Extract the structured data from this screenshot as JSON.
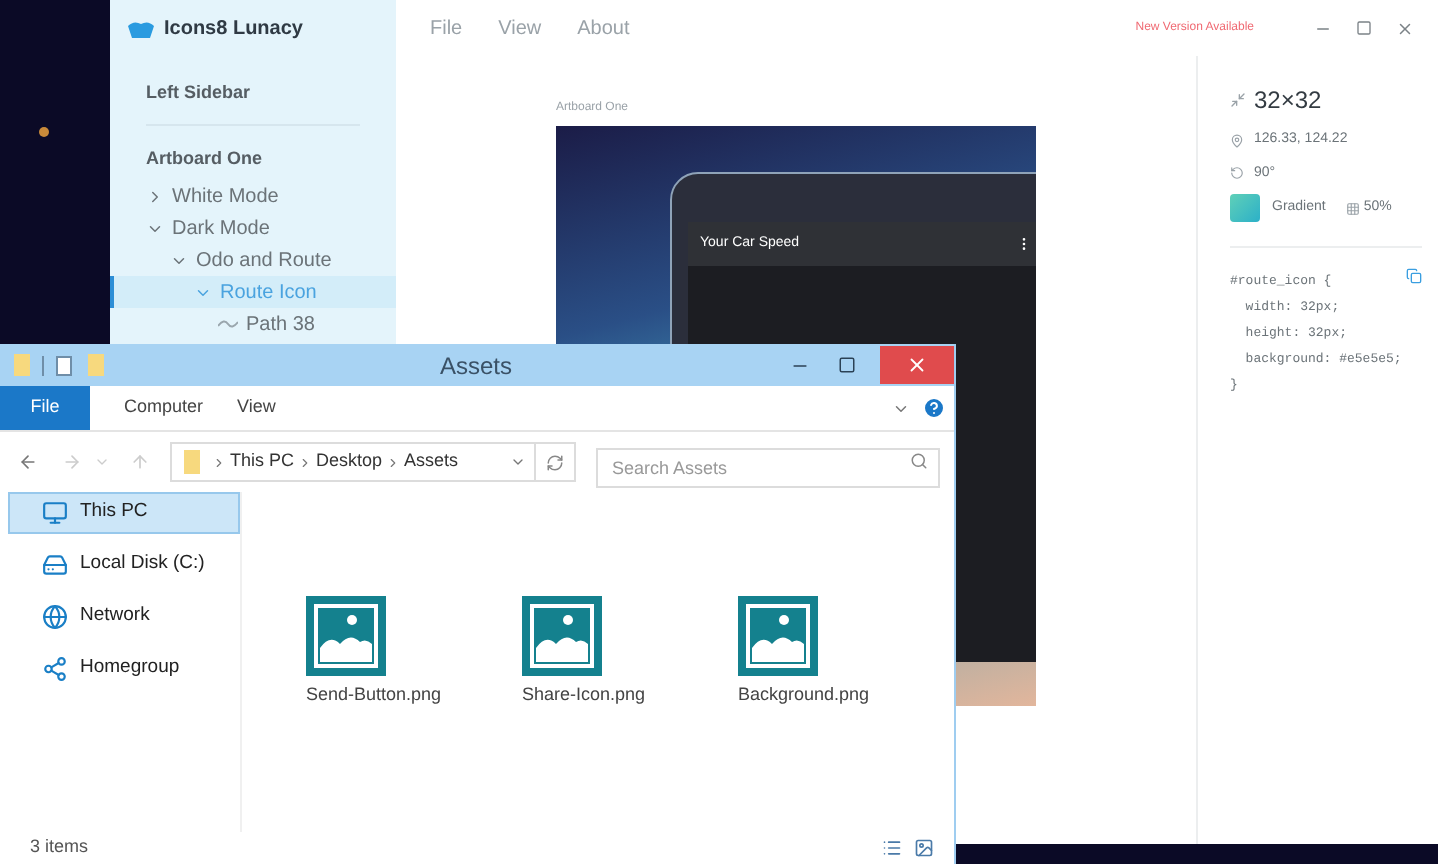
{
  "lunacy": {
    "title": "Icons8 Lunacy",
    "menu": [
      "File",
      "View",
      "About"
    ],
    "notice": "New Version Available",
    "sidebar": {
      "heading": "Left Sidebar",
      "artboard": "Artboard One",
      "layers": [
        {
          "label": "White Mode",
          "kind": "group",
          "expanded": false,
          "selected": false
        },
        {
          "label": "Dark Mode",
          "kind": "group",
          "expanded": true,
          "selected": false,
          "children": [
            {
              "label": "Odo and Route",
              "kind": "group",
              "expanded": true,
              "selected": false,
              "children": [
                {
                  "label": "Route Icon",
                  "kind": "group",
                  "expanded": true,
                  "selected": true,
                  "children": [
                    {
                      "label": "Path 38",
                      "kind": "path",
                      "selected": false
                    }
                  ]
                }
              ]
            }
          ]
        }
      ]
    },
    "canvas": {
      "artboard_label": "Artboard One",
      "phone_title": "Your Car Speed"
    },
    "inspector": {
      "size": "32×32",
      "position": "126.33, 124.22",
      "rotation": "90°",
      "fill": "Gradient",
      "opacity": "50%",
      "code": [
        "#route_icon {",
        "  width: 32px;",
        "  height: 32px;",
        "  background: #e5e5e5;",
        "}"
      ]
    }
  },
  "explorer": {
    "title": "Assets",
    "file_button": "File",
    "tabs": [
      "Computer",
      "View"
    ],
    "breadcrumb": [
      "This PC",
      "Desktop",
      "Assets"
    ],
    "search": {
      "placeholder": "Search Assets"
    },
    "nav": [
      {
        "label": "This PC",
        "kind": "pc",
        "selected": true
      },
      {
        "label": "Local Disk (C:)",
        "kind": "disk",
        "selected": false
      },
      {
        "label": "Network",
        "kind": "network",
        "selected": false
      },
      {
        "label": "Homegroup",
        "kind": "homegroup",
        "selected": false
      }
    ],
    "files": [
      "Send-Button.png",
      "Share-Icon.png",
      "Background.png"
    ],
    "status": "3 items"
  }
}
